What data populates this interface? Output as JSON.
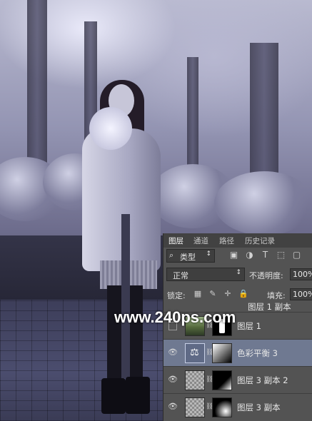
{
  "layers_panel": {
    "tabs": [
      "图层",
      "通道",
      "路径",
      "历史记录"
    ],
    "filter_kind": "类型",
    "blend_mode": "正常",
    "opacity_label": "不透明度:",
    "opacity_value": "100%",
    "lock_label": "锁定:",
    "fill_label": "填充:",
    "fill_value": "100%",
    "top_partial_layer": "图层 1 副本",
    "layers": [
      {
        "name": "图层 1",
        "visible": false
      },
      {
        "name": "色彩平衡 3",
        "visible": true,
        "selected": true
      },
      {
        "name": "图层 3 副本 2",
        "visible": true
      },
      {
        "name": "图层 3 副本",
        "visible": true
      }
    ]
  },
  "watermark": "www.240ps.com",
  "icons": {
    "filter": "search-icon",
    "eye": "eye-icon",
    "balance": "balance-scale-icon"
  }
}
